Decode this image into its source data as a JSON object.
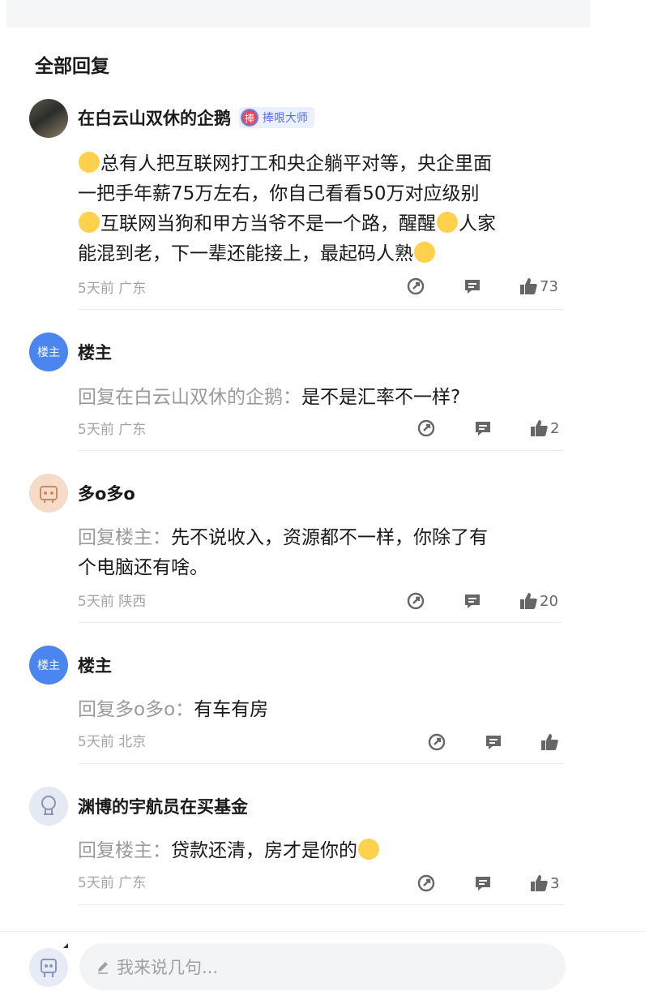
{
  "section_title": "全部回复",
  "comments": [
    {
      "name": "在白云山双休的企鹅",
      "badge": "捧哏大师",
      "badge_icon": "捧",
      "lines": [
        "总有人把互联网打工和央企躺平对等，央企里面",
        "一把手年薪75万左右，你自己看看50万对应级别",
        "互联网当狗和甲方当爷不是一个路，醒醒",
        "人家",
        "能混到老，下一辈还能接上，最起码人熟"
      ],
      "meta": "5天前 广东",
      "likes": "73"
    },
    {
      "name": "楼主",
      "avatar_text": "楼主",
      "reply_prefix": "回复在白云山双休的企鹅：",
      "text": "是不是汇率不一样?",
      "meta": "5天前 广东",
      "likes": "2"
    },
    {
      "name": "多o多o",
      "reply_prefix": "回复楼主：",
      "lines": [
        "先不说收入，资源都不一样，你除了有",
        "个电脑还有啥。"
      ],
      "meta": "5天前 陕西",
      "likes": "20"
    },
    {
      "name": "楼主",
      "avatar_text": "楼主",
      "reply_prefix": "回复多o多o：",
      "text": "有车有房",
      "meta": "5天前 北京",
      "likes": ""
    },
    {
      "name": "渊博的宇航员在买基金",
      "reply_prefix": "回复楼主：",
      "text": "贷款还清，房才是你的",
      "meta": "5天前 广东",
      "likes": "3"
    }
  ],
  "input": {
    "placeholder": "我来说几句..."
  },
  "colors": {
    "accent": "#4b85f0",
    "badge_bg": "#eaf0fd",
    "meta": "#a4a4a4",
    "reply_prefix": "#9a9a9a"
  },
  "icons": {
    "share": "share-icon",
    "reply": "comment-icon",
    "like": "thumbs-up-icon",
    "edit": "pencil-icon"
  }
}
